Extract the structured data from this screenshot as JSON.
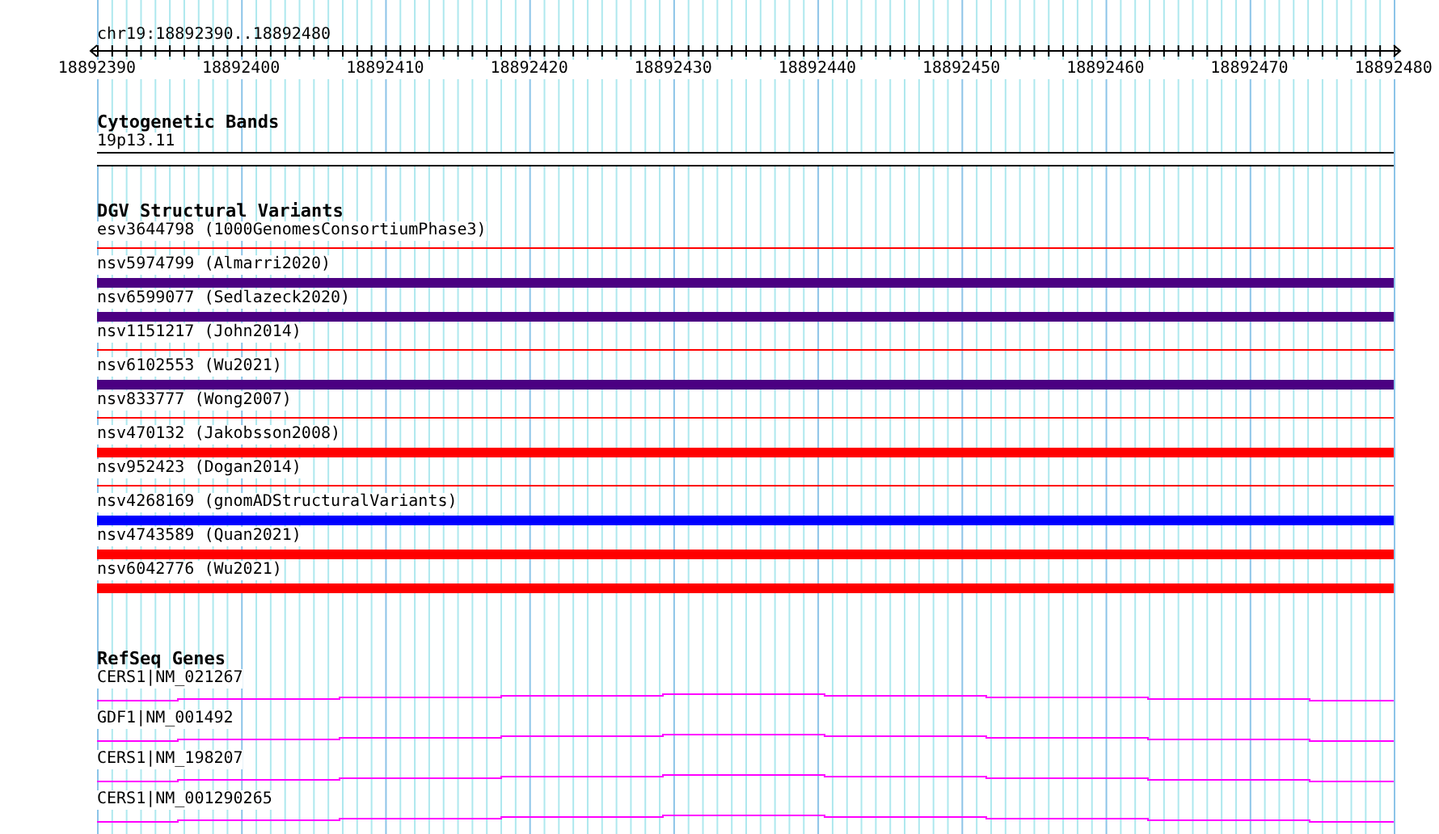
{
  "ruler": {
    "position": "chr19:18892390..18892480",
    "ticks": [
      "18892390",
      "18892400",
      "18892410",
      "18892420",
      "18892430",
      "18892440",
      "18892450",
      "18892460",
      "18892470",
      "18892480"
    ]
  },
  "cytogenetic_bands": {
    "title": "Cytogenetic Bands",
    "bands": [
      {
        "name": "19p13.11"
      }
    ]
  },
  "dgv_structural_variants": {
    "title": "DGV Structural Variants",
    "items": [
      {
        "label": "esv3644798 (1000GenomesConsortiumPhase3)",
        "kind": "line",
        "color": "#ff0000"
      },
      {
        "label": "nsv5974799 (Almarri2020)",
        "kind": "bar",
        "color": "#4b0082"
      },
      {
        "label": "nsv6599077 (Sedlazeck2020)",
        "kind": "bar",
        "color": "#4b0082"
      },
      {
        "label": "nsv1151217 (John2014)",
        "kind": "line",
        "color": "#ff0000"
      },
      {
        "label": "nsv6102553 (Wu2021)",
        "kind": "bar",
        "color": "#4b0082"
      },
      {
        "label": "nsv833777 (Wong2007)",
        "kind": "line",
        "color": "#ff0000"
      },
      {
        "label": "nsv470132 (Jakobsson2008)",
        "kind": "bar",
        "color": "#ff0000"
      },
      {
        "label": "nsv952423 (Dogan2014)",
        "kind": "line",
        "color": "#ff0000"
      },
      {
        "label": "nsv4268169 (gnomADStructuralVariants)",
        "kind": "bar",
        "color": "#0000ff"
      },
      {
        "label": "nsv4743589 (Quan2021)",
        "kind": "bar",
        "color": "#ff0000"
      },
      {
        "label": "nsv6042776 (Wu2021)",
        "kind": "bar",
        "color": "#ff0000"
      }
    ]
  },
  "refseq_genes": {
    "title": "RefSeq Genes",
    "items": [
      {
        "label": "CERS1|NM_021267"
      },
      {
        "label": "GDF1|NM_001492"
      },
      {
        "label": "CERS1|NM_198207"
      },
      {
        "label": "CERS1|NM_001290265"
      }
    ]
  }
}
